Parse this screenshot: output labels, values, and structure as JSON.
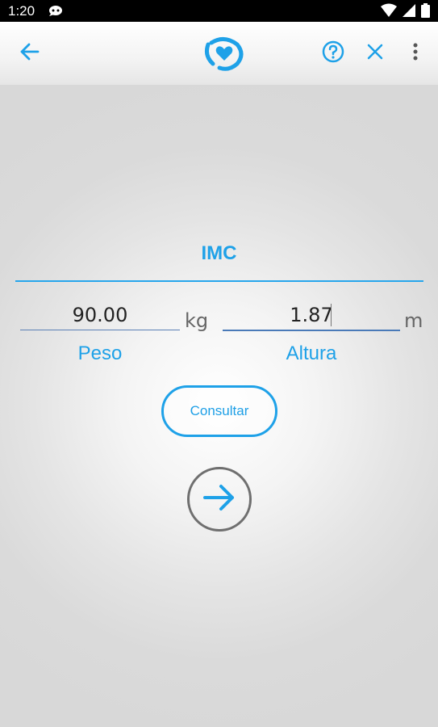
{
  "status_bar": {
    "time": "1:20",
    "icons": [
      "notification-icon",
      "wifi-icon",
      "signal-icon",
      "battery-icon"
    ]
  },
  "toolbar": {
    "icons": [
      "arrow-back-icon",
      "app-logo",
      "help-icon",
      "close-icon",
      "overflow-menu-icon"
    ]
  },
  "form": {
    "title": "IMC",
    "weight": {
      "value": "90.00",
      "unit": "kg",
      "label": "Peso"
    },
    "height": {
      "value": "1.87",
      "unit": "m",
      "label": "Altura"
    },
    "consult_button_label": "Consultar",
    "go_button_icon": "arrow-right-icon"
  },
  "colors": {
    "accent": "#1ea1e8",
    "divider": "#27a6ec",
    "unit_text": "#666666",
    "button_border_gray": "#6f6f6f"
  }
}
